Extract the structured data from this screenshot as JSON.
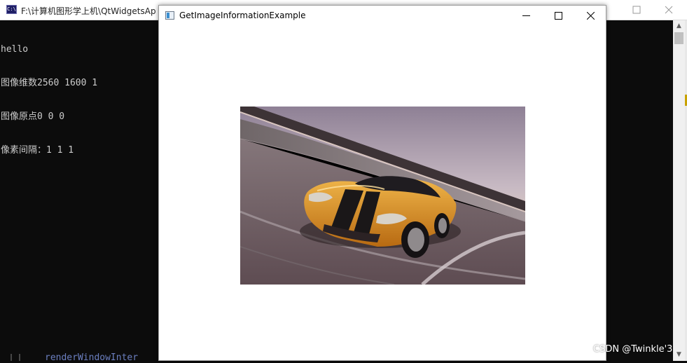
{
  "console": {
    "title": "F:\\计算机图形学上机\\QtWidgetsAp",
    "app_icon": "console-icon",
    "output_lines": [
      "hello",
      "图像维数2560 1600 1",
      "图像原点0 0 0",
      "像素间隔：1 1 1"
    ],
    "bottom_text": "renderWindowInter"
  },
  "qt_window": {
    "title": "GetImageInformationExample",
    "app_icon": "window-icon",
    "controls": [
      "minimize-icon",
      "maximize-icon",
      "close-icon"
    ]
  },
  "render_view": {
    "image": "orange sports car on racetrack"
  },
  "watermark": "CSDN @Twinkle'3"
}
